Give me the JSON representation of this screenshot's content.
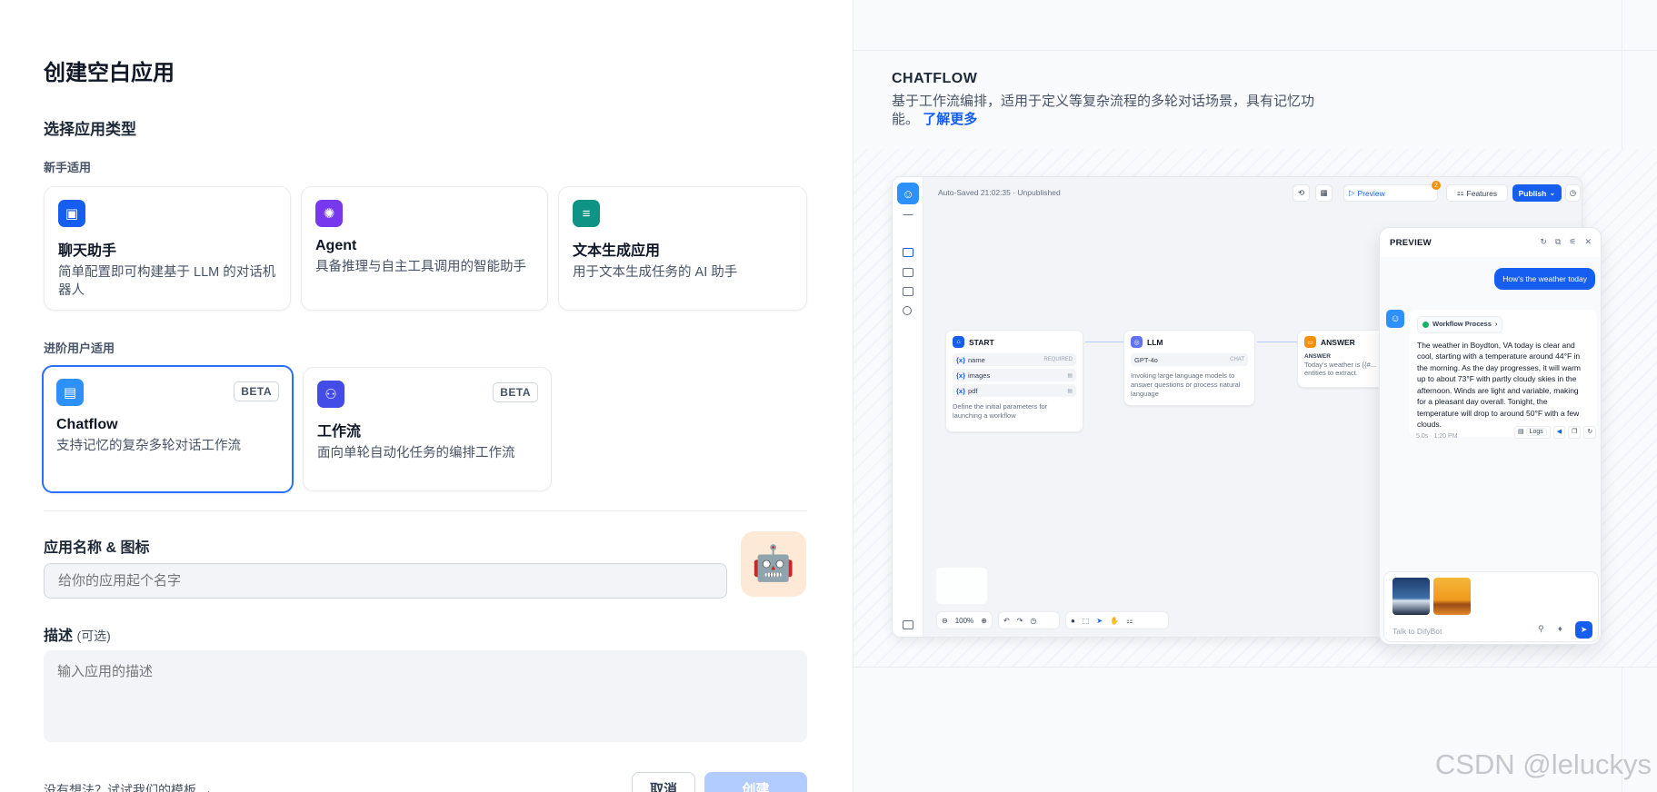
{
  "left": {
    "title": "创建空白应用",
    "section_title": "选择应用类型",
    "beginner_label": "新手适用",
    "advanced_label": "进阶用户适用",
    "cards": [
      {
        "name": "聊天助手",
        "desc": "简单配置即可构建基于 LLM 的对话机器人",
        "icon": "chat-bot-icon",
        "color": "#155eef"
      },
      {
        "name": "Agent",
        "desc": "具备推理与自主工具调用的智能助手",
        "icon": "agent-icon",
        "color": "#7839ee"
      },
      {
        "name": "文本生成应用",
        "desc": "用于文本生成任务的 AI 助手",
        "icon": "text-generation-icon",
        "color": "#0e9384"
      },
      {
        "name": "Chatflow",
        "desc": "支持记忆的复杂多轮对话工作流",
        "icon": "chatflow-icon",
        "color": "#2e90fa",
        "badge": "BETA",
        "selected": true
      },
      {
        "name": "工作流",
        "desc": "面向单轮自动化任务的编排工作流",
        "icon": "workflow-icon",
        "color": "#444ce7",
        "badge": "BETA"
      }
    ],
    "name_label": "应用名称 & 图标",
    "name_placeholder": "给你的应用起个名字",
    "app_emoji": "🤖",
    "desc_label": "描述",
    "desc_optional": "(可选)",
    "desc_placeholder": "输入应用的描述",
    "template_link": "没有想法？试试我们的模板 →",
    "cancel": "取消",
    "create": "创建"
  },
  "right": {
    "title": "CHATFLOW",
    "desc": "基于工作流编排，适用于定义等复杂流程的多轮对话场景，具有记忆功能。",
    "learn_more": "了解更多",
    "preview": {
      "autosave": "Auto-Saved 21:02:35 · Unpublished",
      "toolbar": {
        "preview": "Preview",
        "features": "Features",
        "publish": "Publish",
        "badge": "2"
      },
      "nodes": {
        "start": {
          "title": "START",
          "vars": [
            {
              "v": "{x}",
              "name": "name",
              "tag": "REQUIRED"
            },
            {
              "v": "{x}",
              "name": "images",
              "tag": ""
            },
            {
              "v": "{x}",
              "name": "pdf",
              "tag": ""
            }
          ],
          "desc": "Define the initial parameters for launching a workflow"
        },
        "llm": {
          "title": "LLM",
          "model": "GPT-4o",
          "tag": "CHAT",
          "desc": "Invoking large language models to answer questions or process natural language"
        },
        "answer": {
          "title": "ANSWER",
          "label": "ANSWER",
          "text": "Today's weather is {{#...",
          "text2": "entities to extract."
        }
      },
      "zoom": "100%",
      "chat": {
        "title": "PREVIEW",
        "user_msg": "How's the weather today",
        "workflow_tag": "Workflow Process",
        "answer": "The weather in Boydton, VA today is clear and cool, starting with a temperature around 44°F in the morning. As the day progresses, it will warm up to about 73°F with partly cloudy skies in the afternoon. Winds are light and variable, making for a pleasant day overall. Tonight, the temperature will drop to around 50°F with a few clouds.",
        "meta": "5.0s · 1:20 PM",
        "logs": "Logs",
        "placeholder": "Talk to DifyBot"
      }
    }
  },
  "watermark": "CSDN @leluckys",
  "colors": {
    "accent": "#155eef",
    "selected_border": "#2970ff"
  }
}
